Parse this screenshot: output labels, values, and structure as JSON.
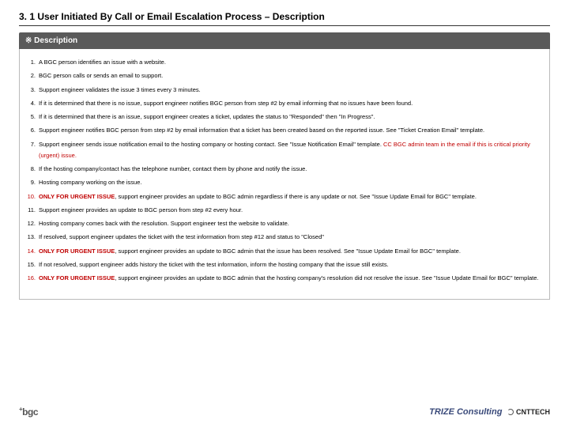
{
  "title": "3. 1 User Initiated By Call or Email Escalation Process – Description",
  "desc_header": "※ Description",
  "items": [
    {
      "n": "1.",
      "text": "A BGC person identifies an issue with a website."
    },
    {
      "n": "2.",
      "text": "BGC person calls or sends an email to support."
    },
    {
      "n": "3.",
      "text": "Support engineer validates the issue 3 times every 3 minutes."
    },
    {
      "n": "4.",
      "text": "If it is determined that there is no issue, support engineer notifies BGC person from step #2 by email informing that no issues have been found."
    },
    {
      "n": "5.",
      "text": "If it is determined that there is an issue, support engineer creates a ticket, updates the status to \"Responded\" then \"In Progress\"."
    },
    {
      "n": "6.",
      "text": "Support engineer notifies BGC person from step #2 by email information that a ticket has been created based on the reported issue.  See \"Ticket Creation Email\" template."
    },
    {
      "n": "7.",
      "pre": "Support engineer sends issue notification email to the hosting company or hosting contact.  See \"Issue Notification Email\" template.  ",
      "red": "CC BGC admin team in the email if this is critical priority (urgent) issue."
    },
    {
      "n": "8.",
      "text": "If the hosting company/contact has the telephone number, contact them by phone and notify the issue."
    },
    {
      "n": "9.",
      "text": "Hosting company working on the issue."
    },
    {
      "n": "10.",
      "red_num": true,
      "pre_red": "ONLY FOR URGENT ISSUE",
      "post": ", support engineer provides an update to BGC admin regardless if there is any update or not.  See \"Issue Update Email for BGC\" template."
    },
    {
      "n": "11.",
      "text": "Support engineer provides an update to BGC person from step #2 every hour."
    },
    {
      "n": "12.",
      "text": "Hosting company comes back with the resolution.  Support engineer test the website to validate."
    },
    {
      "n": "13.",
      "text": "If resolved, support engineer updates the ticket with the test information from step #12 and status to \"Closed\""
    },
    {
      "n": "14.",
      "red_num": true,
      "pre_red": "ONLY FOR URGENT ISSUE",
      "post": ", support engineer provides an update to BGC admin that the issue has been resolved.  See \"Issue Update Email for BGC\" template."
    },
    {
      "n": "15.",
      "text": "If not resolved, support engineer adds history the ticket with the test information, inform the hosting company that the issue still exists."
    },
    {
      "n": "16.",
      "red_num": true,
      "pre_red": "ONLY FOR URGENT ISSUE",
      "post": ", support engineer provides an update to BGC admin that the hosting company's resolution did not resolve the issue.  See \"Issue Update Email for BGC\" template."
    }
  ],
  "footer": {
    "left_plus": "+",
    "left": "bgc",
    "right_trize": "TRIZE Consulting",
    "right_cnt": "CNTTECH"
  }
}
